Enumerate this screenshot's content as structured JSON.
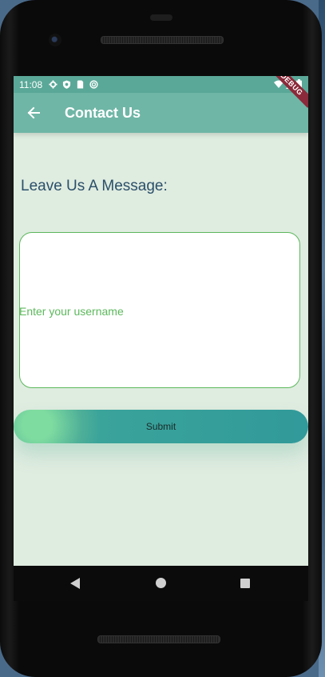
{
  "status_bar": {
    "time": "11:08",
    "left_icons": [
      "settings-icon",
      "shield-icon",
      "sim-card-icon",
      "sync-icon"
    ],
    "right_icons": [
      "wifi-icon",
      "signal-icon",
      "battery-icon"
    ]
  },
  "app_bar": {
    "title": "Contact Us",
    "back_icon": "arrow-left-icon",
    "debug_banner": "DEBUG"
  },
  "form": {
    "heading": "Leave Us A Message:",
    "message_placeholder": "Enter your username",
    "submit_label": "Submit"
  },
  "nav_bar": {
    "buttons": [
      "back-triangle-icon",
      "home-circle-icon",
      "recents-square-icon"
    ]
  },
  "colors": {
    "status_bar": "#5aa898",
    "app_bar": "#6fb6a6",
    "background": "#dfece0",
    "heading_text": "#2b4f6a",
    "field_border": "#5cb85c",
    "submit_button": "#319a9a"
  }
}
